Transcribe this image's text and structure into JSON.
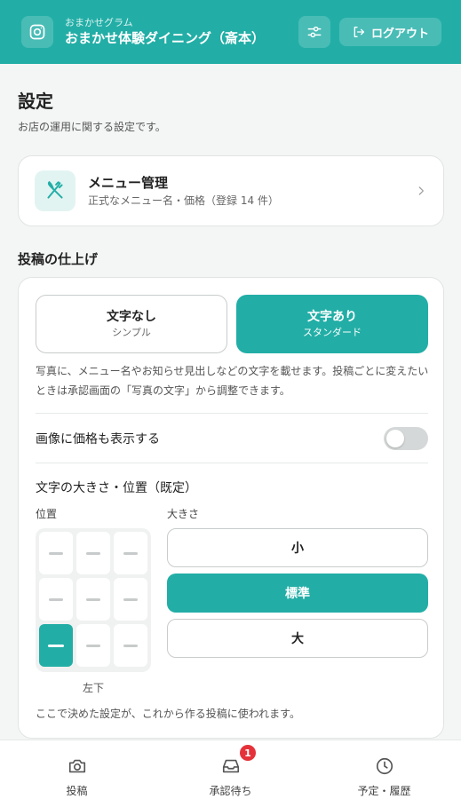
{
  "header": {
    "subtitle": "おまかせグラム",
    "title": "おまかせ体験ダイニング（斎本）",
    "logout_label": "ログアウト",
    "accent_color": "#22aea6"
  },
  "page": {
    "title": "設定",
    "subtitle": "お店の運用に関する設定です。"
  },
  "menu_card": {
    "title": "メニュー管理",
    "description": "正式なメニュー名・価格（登録 14 件）",
    "icon": "fork-knife-icon"
  },
  "finish": {
    "section_title": "投稿の仕上げ",
    "options": [
      {
        "title": "文字なし",
        "sub": "シンプル",
        "selected": false
      },
      {
        "title": "文字あり",
        "sub": "スタンダード",
        "selected": true
      }
    ],
    "description": "写真に、メニュー名やお知らせ見出しなどの文字を載せます。投稿ごとに変えたいときは承認画面の「写真の文字」から調整できます。",
    "price_toggle_label": "画像に価格も表示する",
    "price_toggle_on": false,
    "text_heading": "文字の大きさ・位置（既定）",
    "position_label": "位置",
    "size_label": "大きさ",
    "position_selected": "左下",
    "sizes": [
      {
        "label": "小",
        "selected": false
      },
      {
        "label": "標準",
        "selected": true
      },
      {
        "label": "大",
        "selected": false
      }
    ],
    "footnote": "ここで決めた設定が、これから作る投稿に使われます。"
  },
  "nav": {
    "items": [
      {
        "label": "投稿",
        "icon": "camera-icon"
      },
      {
        "label": "承認待ち",
        "icon": "inbox-icon",
        "badge": "1"
      },
      {
        "label": "予定・履歴",
        "icon": "clock-icon"
      }
    ]
  }
}
